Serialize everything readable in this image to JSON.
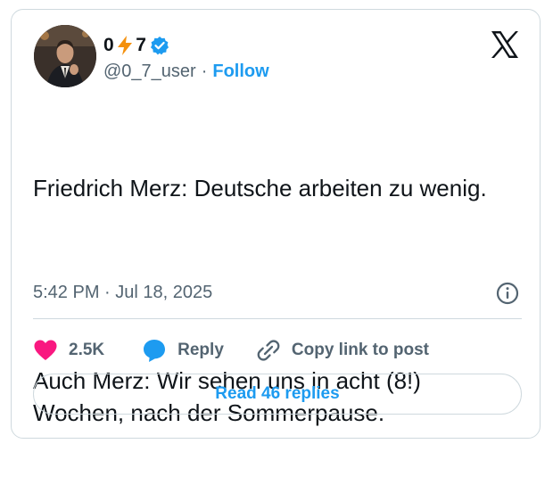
{
  "author": {
    "display_name_prefix": "0",
    "display_name_suffix": "7",
    "display_name_emoji": "bolt-emoji",
    "verified_color": "#1d9bf0",
    "handle": "@0_7_user",
    "separator": "·",
    "follow_label": "Follow"
  },
  "tweet": {
    "lines": [
      "Friedrich Merz: Deutsche arbeiten zu wenig.",
      "Auch Merz: Wir sehen uns in acht (8!) Wochen, nach der Sommerpause."
    ],
    "timestamp": "5:42 PM · Jul 18, 2025"
  },
  "actions": {
    "like_count": "2.5K",
    "like_color": "#f91880",
    "reply_label": "Reply",
    "reply_color": "#1d9bf0",
    "copy_link_label": "Copy link to post"
  },
  "footer": {
    "read_replies_label": "Read 46 replies"
  },
  "colors": {
    "accent": "#1d9bf0",
    "secondary_text": "#536471",
    "border": "#cfd9de"
  }
}
